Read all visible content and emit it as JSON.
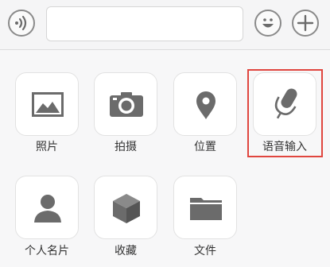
{
  "input_bar": {
    "voice_icon": "voice-wave-icon",
    "text_value": "",
    "emoji_icon": "smiley-face-icon",
    "plus_icon": "plus-icon"
  },
  "actions": [
    {
      "label": "照片",
      "icon": "photo-icon"
    },
    {
      "label": "拍摄",
      "icon": "camera-icon"
    },
    {
      "label": "位置",
      "icon": "location-pin-icon"
    },
    {
      "label": "语音输入",
      "icon": "microphone-icon",
      "highlighted": true
    },
    {
      "label": "个人名片",
      "icon": "contact-card-icon"
    },
    {
      "label": "收藏",
      "icon": "favorites-box-icon"
    },
    {
      "label": "文件",
      "icon": "folder-icon"
    }
  ],
  "colors": {
    "icon": "#6b6b6b",
    "highlight_border": "#e0463f",
    "tile_bg": "#ffffff",
    "panel_bg": "#f7f7f8"
  }
}
